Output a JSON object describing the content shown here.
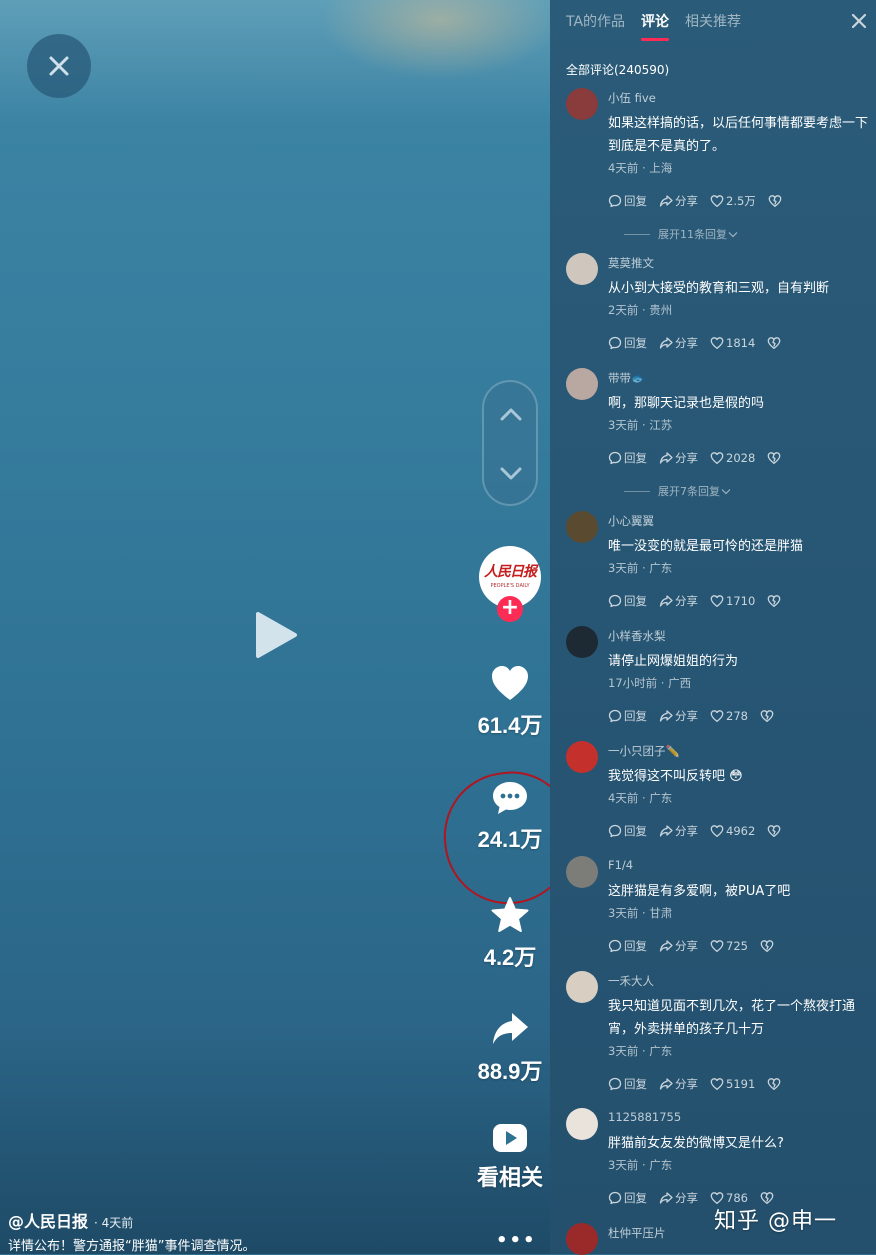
{
  "video": {
    "author": "@人民日报",
    "time": "· 4天前",
    "caption": "详情公布！警方通报“胖猫”事件调查情况。",
    "avatar_logo": "人民日报",
    "avatar_logo_en": "PEOPLE'S DAILY",
    "follow_plus": "+",
    "likes": "61.4万",
    "comments": "24.1万",
    "favorites": "4.2万",
    "shares": "88.9万",
    "related_label": "看相关",
    "more": "•••"
  },
  "panel": {
    "tabs": [
      "TA的作品",
      "评论",
      "相关推荐"
    ],
    "active_tab": 1,
    "total": "全部评论(240590)",
    "reply_label": "回复",
    "share_label": "分享",
    "comments": [
      {
        "name": "小伍 five",
        "text": "如果这样搞的话，以后任何事情都要考虑一下到底是不是真的了。",
        "meta": "4天前 · 上海",
        "likes": "2.5万",
        "avatar_color": "#8a3b3b",
        "expand": "展开11条回复"
      },
      {
        "name": "莫莫推文",
        "text": "从小到大接受的教育和三观，自有判断",
        "meta": "2天前 · 贵州",
        "likes": "1814",
        "avatar_color": "#cfc7bd",
        "expand": ""
      },
      {
        "name": "带带🐟",
        "text": "啊，那聊天记录也是假的吗",
        "meta": "3天前 · 江苏",
        "likes": "2028",
        "avatar_color": "#b9a7a2",
        "expand": "展开7条回复"
      },
      {
        "name": "小心翼翼",
        "text": "唯一没变的就是最可怜的还是胖猫",
        "meta": "3天前 · 广东",
        "likes": "1710",
        "avatar_color": "#5a4a30",
        "expand": ""
      },
      {
        "name": "小样香水梨",
        "text": "请停止网爆姐姐的行为",
        "meta": "17小时前 · 广西",
        "likes": "278",
        "avatar_color": "#1e2a33",
        "expand": ""
      },
      {
        "name": "一小只团子✏️",
        "text": "我觉得这不叫反转吧 😳",
        "meta": "4天前 · 广东",
        "likes": "4962",
        "avatar_color": "#c4302b",
        "expand": ""
      },
      {
        "name": "F1/4",
        "text": "这胖猫是有多爱啊，被PUA了吧",
        "meta": "3天前 · 甘肃",
        "likes": "725",
        "avatar_color": "#7c7c78",
        "expand": ""
      },
      {
        "name": "一禾大人",
        "text": "我只知道见面不到几次，花了一个熬夜打通宵，外卖拼单的孩子几十万",
        "meta": "3天前 · 广东",
        "likes": "5191",
        "avatar_color": "#d8cfc2",
        "expand": ""
      },
      {
        "name": "1125881755",
        "text": "胖猫前女友发的微博又是什么?",
        "meta": "3天前 · 广东",
        "likes": "786",
        "avatar_color": "#e9e3dc",
        "expand": ""
      },
      {
        "name": "杜仲平压片",
        "text": "",
        "meta": "",
        "likes": "",
        "avatar_color": "#9a2a2a",
        "expand": ""
      }
    ]
  },
  "watermark": "知乎 @申一",
  "colors": {
    "accent": "#fe2c55",
    "annotation": "#b01520"
  }
}
